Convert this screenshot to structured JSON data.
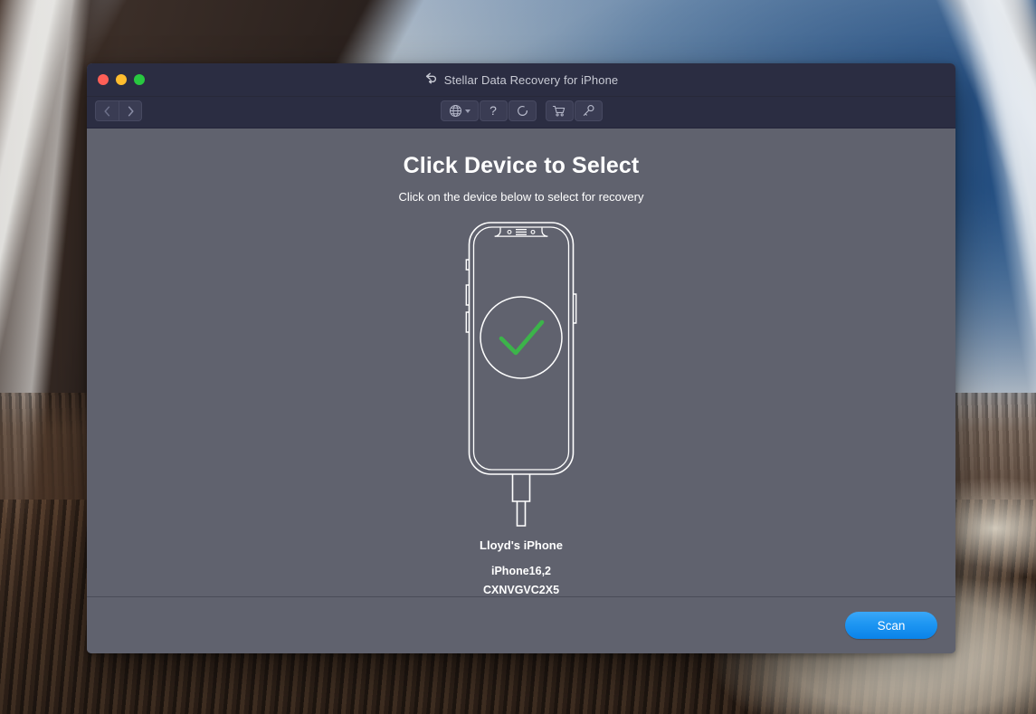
{
  "window": {
    "title": "Stellar Data Recovery for iPhone",
    "title_icon": "recovery-arrow-icon",
    "traffic_lights": [
      {
        "name": "close",
        "color": "#ff5f57"
      },
      {
        "name": "minimize",
        "color": "#ffbd2e"
      },
      {
        "name": "zoom",
        "color": "#28c840"
      }
    ]
  },
  "toolbar": {
    "back_label": "‹",
    "forward_label": "›",
    "buttons": [
      {
        "name": "language-globe-button",
        "icon": "globe-icon",
        "has_caret": true
      },
      {
        "name": "help-button",
        "icon": "question-mark-icon"
      },
      {
        "name": "refresh-button",
        "icon": "refresh-icon"
      },
      {
        "name": "buy-now-button",
        "icon": "shopping-cart-icon"
      },
      {
        "name": "activate-key-button",
        "icon": "key-icon"
      }
    ]
  },
  "main": {
    "heading": "Click Device to Select",
    "subheading": "Click on the device below to select for recovery",
    "device": {
      "name": "Lloyd's iPhone",
      "model": "iPhone16,2",
      "serial": "CXNVGVC2X5",
      "status_icon": "green-checkmark-icon",
      "connected": true
    }
  },
  "footer": {
    "scan_label": "Scan"
  },
  "colors": {
    "titlebar": "#2b2d42",
    "body": "#60626e",
    "accent_blue": "#1e96f2",
    "check_green": "#3cb44a",
    "text_primary": "#ffffff",
    "text_title": "#c8cad4"
  }
}
